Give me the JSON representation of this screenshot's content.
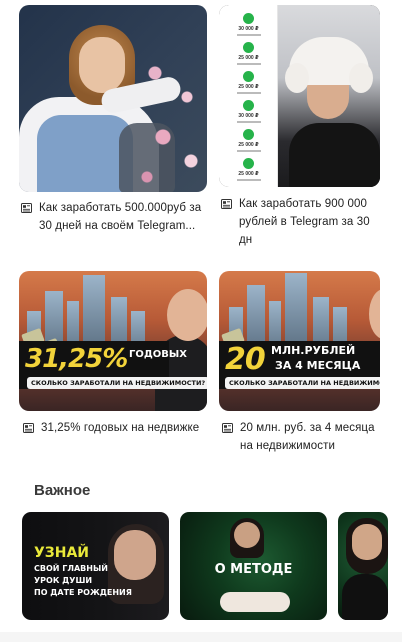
{
  "feed": {
    "cards": [
      {
        "caption": "Как заработать 500.000руб за 30 дней на своём Telegram..."
      },
      {
        "caption": "Как заработать 900 000 рублей в Telegram за 30 дн"
      },
      {
        "caption": "31,25% годовых на недвижке"
      },
      {
        "caption": "20 млн. руб. за 4 месяца на недвижимости"
      }
    ],
    "list_amounts": [
      "30 000 ₽",
      "25 000 ₽",
      "25 000 ₽",
      "30 000 ₽",
      "25 000 ₽",
      "25 000 ₽"
    ],
    "banner1": {
      "headline_yellow": "31,25%",
      "headline_white": "ГОДОВЫХ",
      "pill": "СКОЛЬКО ЗАРАБОТАЛИ НА НЕДВИЖИМОСТИ?"
    },
    "banner2": {
      "headline_yellow": "20",
      "headline_white_1": "МЛН.РУБЛЕЙ",
      "headline_white_2": "ЗА 4 МЕСЯЦА",
      "pill": "СКОЛЬКО ЗАРАБОТАЛИ НА НЕДВИЖИМОСТИ?"
    }
  },
  "section": {
    "title": "Важное",
    "promos": [
      {
        "line1": "УЗНАЙ",
        "line2": "СВОЙ ГЛАВНЫЙ",
        "line3": "УРОК ДУШИ",
        "line4": "ПО ДАТЕ РОЖДЕНИЯ"
      },
      {
        "title": "О МЕТОДЕ"
      }
    ]
  },
  "colors": {
    "accent_yellow": "#f2d33a",
    "green_check": "#26b34a",
    "text": "#222222"
  },
  "icons": [
    "article-icon"
  ]
}
